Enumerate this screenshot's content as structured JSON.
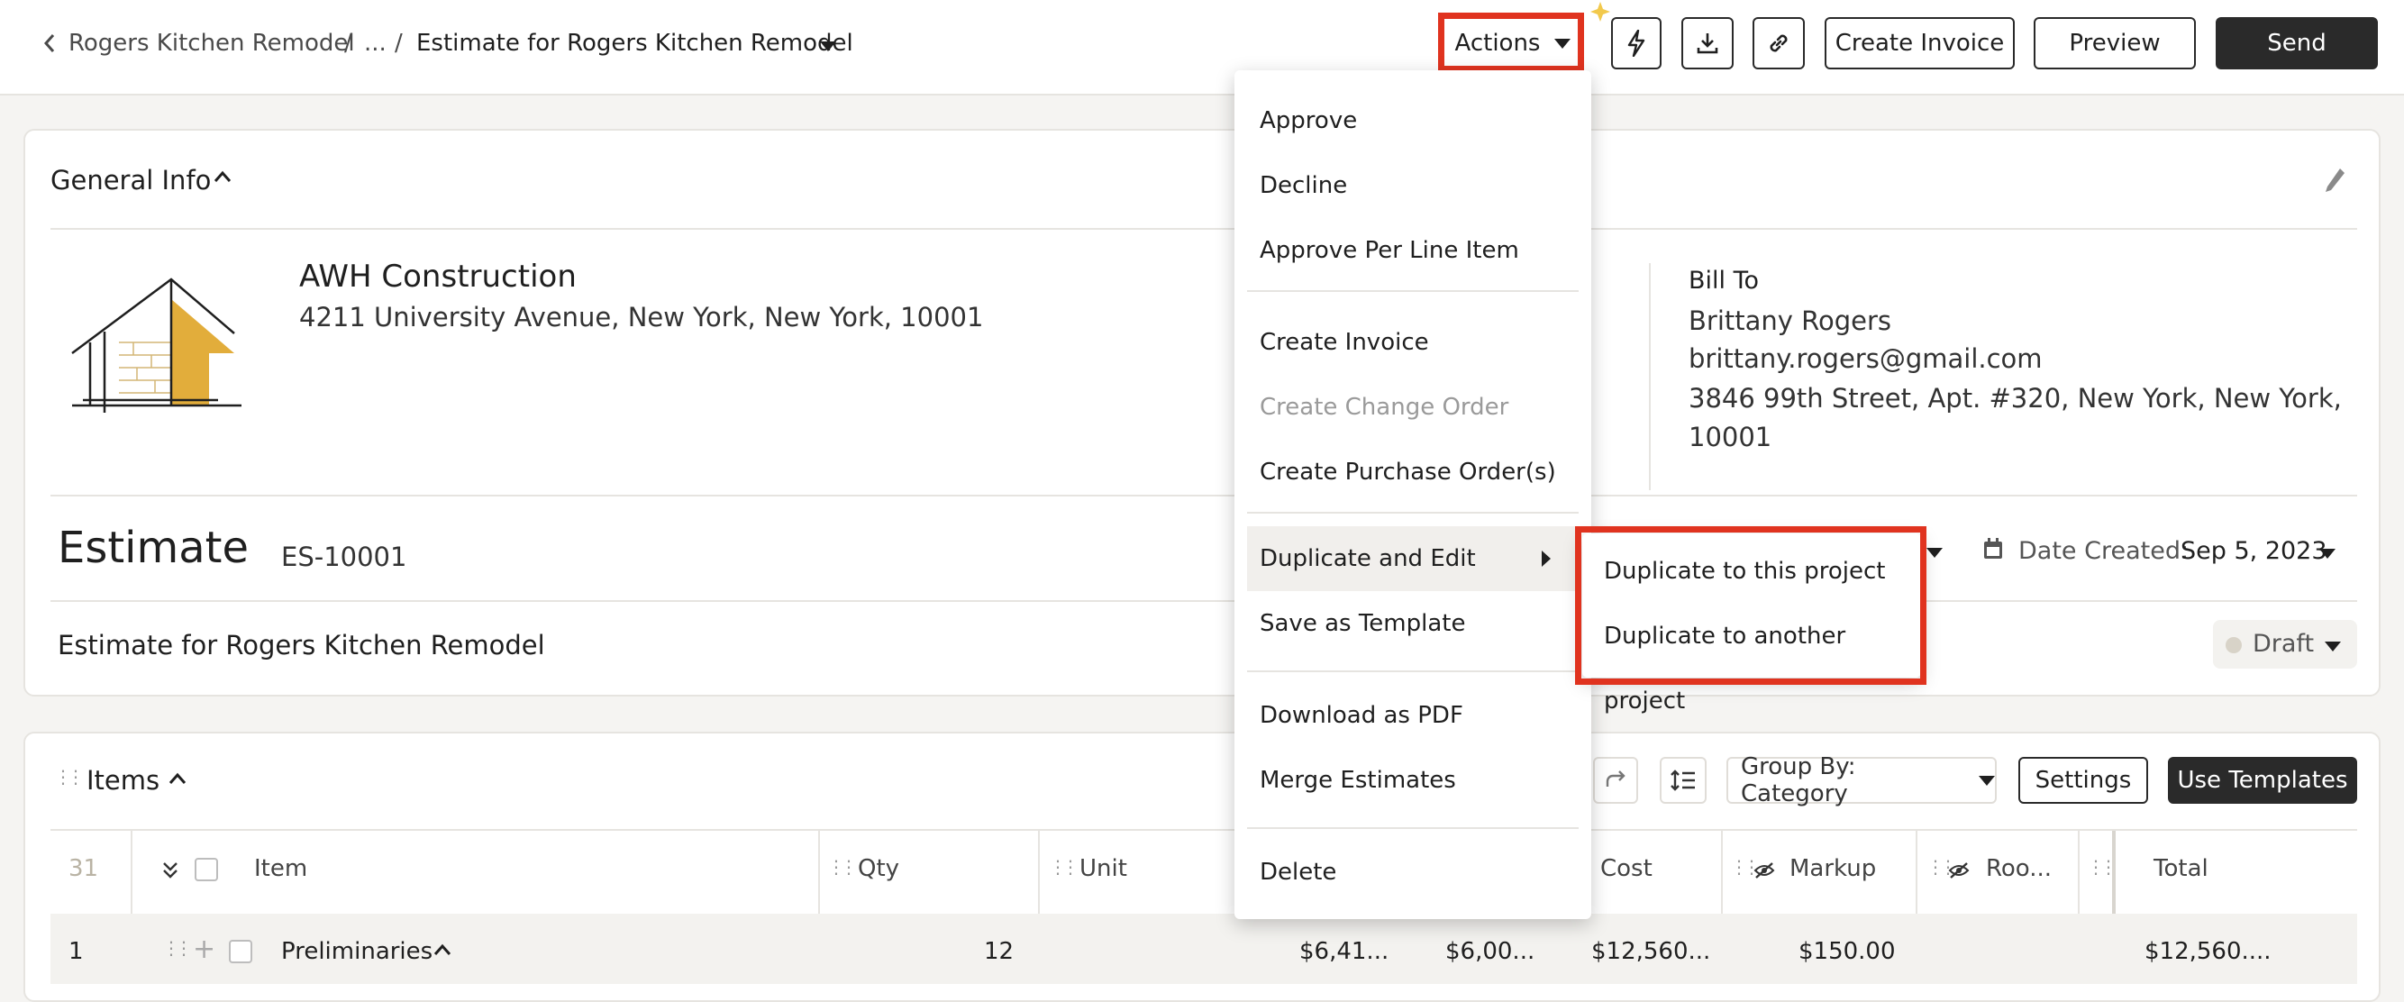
{
  "breadcrumb": {
    "project": "Rogers Kitchen Remodel",
    "sep1": "/",
    "ellipsis": "...",
    "sep2": "/",
    "current": "Estimate for Rogers Kitchen Remodel"
  },
  "toolbar": {
    "actions_label": "Actions",
    "create_invoice_label": "Create Invoice",
    "preview_label": "Preview",
    "send_label": "Send"
  },
  "general_info": {
    "title": "General Info",
    "company_name": "AWH Construction",
    "company_address": "4211 University Avenue, New York, New York, 10001",
    "bill_to_label": "Bill To",
    "bill_to_name": "Brittany Rogers",
    "bill_to_email": "brittany.rogers@gmail.com",
    "bill_to_address_line1": "3846 99th Street, Apt. #320, New York, New York,",
    "bill_to_address_line2": "10001",
    "doc_type": "Estimate",
    "doc_number": "ES-10001",
    "date_created_label": "Date Created:",
    "date_created_value": "Sep 5, 2023",
    "doc_title": "Estimate for Rogers Kitchen Remodel",
    "status": "Draft"
  },
  "actions_menu": {
    "items": [
      "Approve",
      "Decline",
      "Approve Per Line Item",
      "Create Invoice",
      "Create Change Order",
      "Create Purchase Order(s)",
      "Duplicate and Edit",
      "Save as Template",
      "Download as PDF",
      "Merge Estimates",
      "Delete"
    ]
  },
  "submenu": {
    "items": [
      "Duplicate to this project",
      "Duplicate to another project"
    ]
  },
  "items_section": {
    "title": "Items",
    "group_by_label": "Group By: Category",
    "settings_label": "Settings",
    "use_templates_label": "Use Templates",
    "row_count": "31",
    "columns": {
      "item": "Item",
      "qty": "Qty",
      "unit": "Unit",
      "cost": "Cost",
      "markup": "Markup",
      "room": "Roo...",
      "total": "Total"
    },
    "row": {
      "index": "1",
      "name": "Preliminaries",
      "qty": "12",
      "c1": "$6,41...",
      "c2": "$6,00...",
      "cost": "$12,560...",
      "markup": "$150.00",
      "total": "$12,560...."
    }
  },
  "colors": {
    "accent_red": "#e0331f",
    "dark_button": "#2a2a2a",
    "logo_gold": "#e2ad3b"
  }
}
